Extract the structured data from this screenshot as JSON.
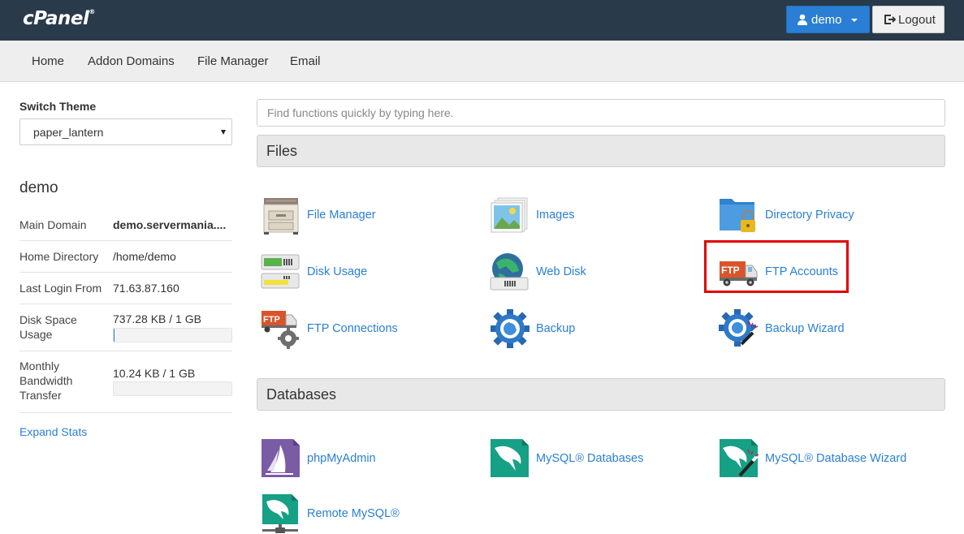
{
  "header": {
    "logo": "cPanel",
    "logo_mark": "®",
    "user_label": "demo",
    "logout_label": "Logout"
  },
  "nav": {
    "items": [
      "Home",
      "Addon Domains",
      "File Manager",
      "Email"
    ]
  },
  "sidebar": {
    "switch_theme_label": "Switch Theme",
    "theme_value": "paper_lantern",
    "username": "demo",
    "stats": [
      {
        "label": "Main Domain",
        "value": "demo.servermania...."
      },
      {
        "label": "Home Directory",
        "value": "/home/demo"
      },
      {
        "label": "Last Login From",
        "value": "71.63.87.160"
      },
      {
        "label": "Disk Space Usage",
        "value": "737.28 KB / 1 GB",
        "usage": 0.0007
      },
      {
        "label": "Monthly Bandwidth Transfer",
        "value": "10.24 KB / 1 GB",
        "usage": 0.0001
      }
    ],
    "expand_label": "Expand Stats"
  },
  "search": {
    "placeholder": "Find functions quickly by typing here."
  },
  "sections": [
    {
      "title": "Files",
      "items": [
        {
          "label": "File Manager",
          "icon": "file-cabinet-icon"
        },
        {
          "label": "Images",
          "icon": "images-icon"
        },
        {
          "label": "Directory Privacy",
          "icon": "folder-lock-icon"
        },
        {
          "label": "Disk Usage",
          "icon": "disk-usage-icon"
        },
        {
          "label": "Web Disk",
          "icon": "web-disk-icon"
        },
        {
          "label": "FTP Accounts",
          "icon": "ftp-truck-icon"
        },
        {
          "label": "FTP Connections",
          "icon": "ftp-connections-icon"
        },
        {
          "label": "Backup",
          "icon": "backup-gear-icon"
        },
        {
          "label": "Backup Wizard",
          "icon": "backup-wizard-icon"
        }
      ]
    },
    {
      "title": "Databases",
      "items": [
        {
          "label": "phpMyAdmin",
          "icon": "phpmyadmin-icon"
        },
        {
          "label": "MySQL® Databases",
          "icon": "mysql-dolphin-icon"
        },
        {
          "label": "MySQL® Database Wizard",
          "icon": "mysql-wizard-icon"
        },
        {
          "label": "Remote MySQL®",
          "icon": "remote-mysql-icon"
        }
      ]
    }
  ],
  "ftp_badge": "FTP",
  "colors": {
    "topbar": "#293a4a",
    "primary": "#2a7fd4",
    "highlight": "#e30000"
  }
}
